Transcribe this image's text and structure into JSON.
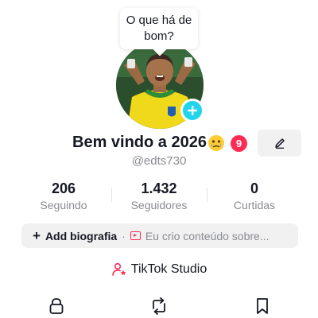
{
  "bubble": {
    "text": "O que há de bom?"
  },
  "profile": {
    "display_name": "Bem vindo a 2026",
    "emoji": "crying-face-emoji",
    "badge_count": "9",
    "username": "@edts730"
  },
  "stats": [
    {
      "value": "206",
      "label": "Seguindo"
    },
    {
      "value": "1.432",
      "label": "Seguidores"
    },
    {
      "value": "0",
      "label": "Curtidas"
    }
  ],
  "bio": {
    "add_label": "Add biografia",
    "separator": "·",
    "creator_text": "Eu crio conteúdo sobre..."
  },
  "studio": {
    "label": "TikTok Studio"
  },
  "tabs": [
    "lock-icon",
    "repost-icon",
    "bookmark-icon"
  ],
  "colors": {
    "accent_red": "#fe2c55",
    "add_button": "#20d5ec",
    "text_primary": "#161823",
    "text_secondary": "#8a8b91",
    "pill_bg": "#f1f1f2"
  }
}
